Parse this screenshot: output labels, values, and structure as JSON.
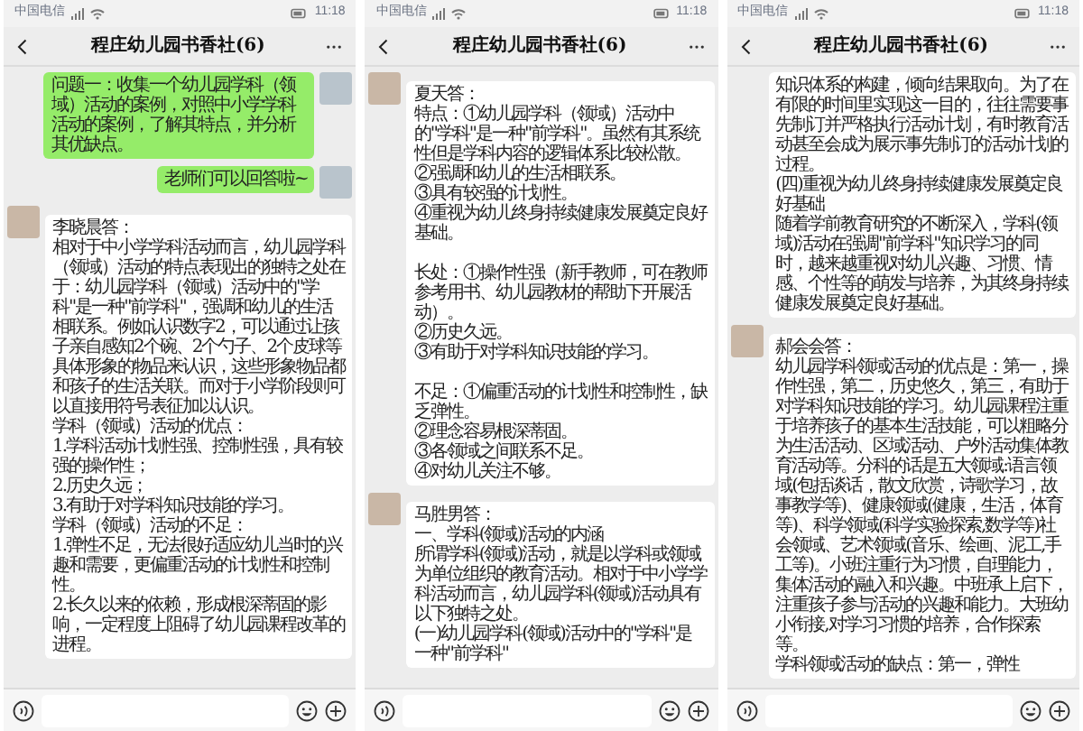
{
  "phones": [
    {
      "status_bar": {
        "carrier": "中国电信",
        "time": "11:18"
      },
      "header": {
        "title": "程庄幼儿园书香社(6)"
      },
      "messages": [
        {
          "kind": "outgoing",
          "sections": [
            [
              "问题一：收集一个幼儿园学科（领域）活动的案例，对照中小学学科活动的案例，了解其特点，并分析其优缺点。"
            ]
          ]
        },
        {
          "kind": "outgoing",
          "sections": [
            [
              "老师们可以回答啦~"
            ]
          ]
        },
        {
          "kind": "incoming",
          "sections": [
            [
              "李晓晨答：",
              "相对于中小学学科活动而言，幼儿园学科（领域）活动的特点表现出的独特之处在于：幼儿园学科（领域）活动中的\"学科\"是一种\"前学科\"，强调和幼儿的生活相联系。例如认识数字2，可以通过让孩子亲自感知2个碗、2个勺子、2个皮球等具体形象的物品来认识，这些形象物品都和孩子的生活关联。而对于小学阶段则可以直接用符号表征加以认识。",
              "学科（领域）活动的优点：",
              "1.学科活动计划性强、控制性强，具有较强的操作性；",
              "2.历史久远；",
              "3.有助于对学科知识技能的学习。",
              "学科（领域）活动的不足：",
              "1.弹性不足，无法很好适应幼儿当时的兴趣和需要，更偏重活动的计划性和控制性。",
              "2.长久以来的依赖，形成根深蒂固的影响，一定程度上阻碍了幼儿园课程改革的进程。"
            ]
          ]
        }
      ]
    },
    {
      "status_bar": {
        "carrier": "中国电信",
        "time": "11:18"
      },
      "header": {
        "title": "程庄幼儿园书香社(6)"
      },
      "messages": [
        {
          "kind": "incoming",
          "sections": [
            [
              "夏天答：",
              "特点：①幼儿园学科（领域）活动中的\"学科\"是一种\"前学科\"。虽然有其系统性但是学科内容的逻辑体系比较松散。",
              "②强调和幼儿的生活相联系。",
              "③具有较强的计划性。",
              "④重视为幼儿终身持续健康发展奠定良好基础。"
            ],
            [
              "长处：①操作性强（新手教师，可在教师参考用书、幼儿园教材的帮助下开展活动）。",
              "②历史久远。",
              "③有助于对学科知识技能的学习。"
            ],
            [
              "不足：①偏重活动的计划性和控制性，缺乏弹性。",
              "②理念容易根深蒂固。",
              "③各领域之间联系不足。",
              "④对幼儿关注不够。"
            ]
          ]
        },
        {
          "kind": "incoming",
          "sections": [
            [
              "马胜男答：",
              "一、学科(领域)活动的内涵",
              "所谓学科(领域)活动，就是以学科或领域为单位组织的教育活动。相对于中小学学科活动而言，幼儿园学科(领域)活动具有以下独特之处。",
              "(一)幼儿园学科(领域)活动中的\"学科\"是一种\"前学科\""
            ]
          ]
        }
      ]
    },
    {
      "status_bar": {
        "carrier": "中国电信",
        "time": "11:18"
      },
      "header": {
        "title": "程庄幼儿园书香社(6)"
      },
      "messages": [
        {
          "kind": "continuation",
          "sections": [
            [
              "知识体系的构建，倾向结果取向。为了在有限的时间里实现这一目的，往往需要事先制订并严格执行活动计划，有时教育活动甚至会成为展示事先制订的活动计划的过程。",
              "(四)重视为幼儿终身持续健康发展奠定良好基础",
              "随着学前教育研究的不断深入，学科(领域)活动在强调\"前学科\"知识学习的同时，越来越重视对幼儿兴趣、习惯、情感、个性等的萌发与培养，为其终身持续健康发展奠定良好基础。"
            ]
          ]
        },
        {
          "kind": "incoming",
          "sections": [
            [
              "郝会会答：",
              "幼儿园学科领域活动的优点是：第一，操作性强，第二，历史悠久，第三，有助于对学科知识技能的学习。幼儿园课程注重于培养孩子的基本生活技能，可以粗略分为生活活动、区域活动、户外活动集体教育活动等。分科的话是五大领域:语言领域(包括谈话，散文欣赏，诗歌学习，故事教学等)、健康领域(健康，生活，体育等)、科学领域(科学实验探索,数学等)社会领域、艺术领域(音乐、绘画、泥工,手工等)。小班注重行为习惯，自理能力，集体活动的融入和兴趣。中班承上启下，注重孩子参与活动的兴趣和能力。大班幼小衔接,对学习习惯的培养，合作探索等。",
              "学科领域活动的缺点：第一，弹性"
            ]
          ]
        }
      ]
    }
  ]
}
